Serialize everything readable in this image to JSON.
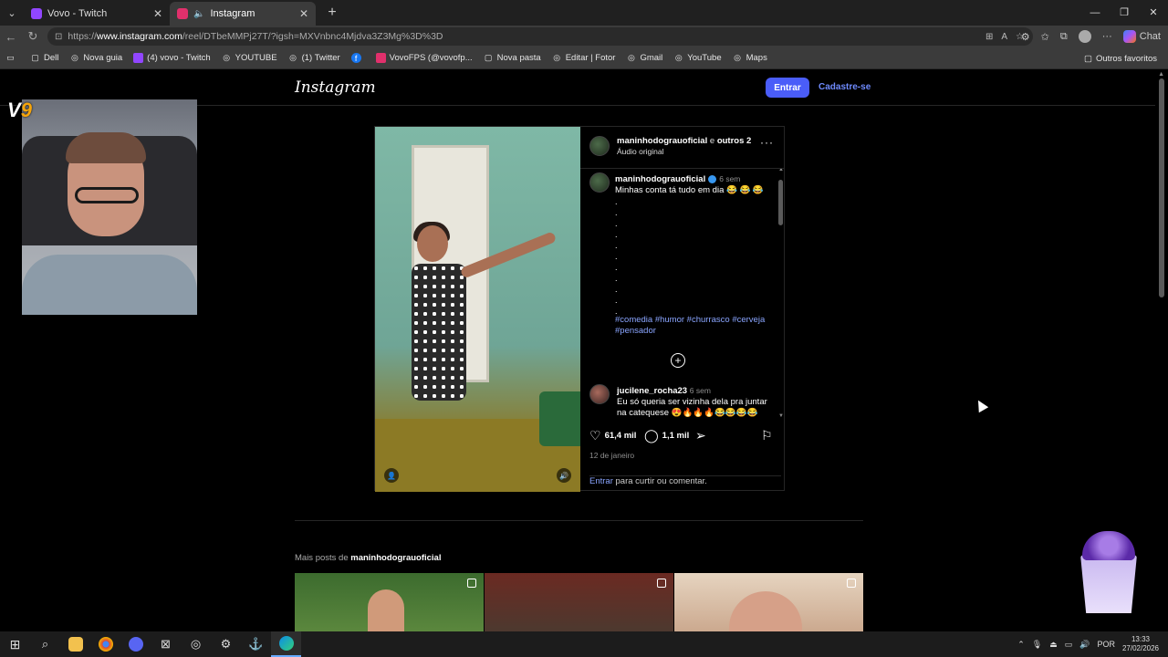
{
  "browser": {
    "tabs": [
      {
        "label": "Vovo - Twitch",
        "color": "#9146ff"
      },
      {
        "label": "Instagram",
        "color": "#e1306c"
      }
    ],
    "url_prefix": "https://",
    "url_host": "www.instagram.com",
    "url_path": "/reel/DTbeMMPj27T/?igsh=MXVnbnc4Mjdva3Z3Mg%3D%3D",
    "chat_label": "Chat",
    "bookmarks": [
      {
        "label": "Dell",
        "icon": "folder-icon"
      },
      {
        "label": "Nova guia",
        "icon": "globe-icon"
      },
      {
        "label": "(4) vovo - Twitch",
        "icon": "twitch-icon"
      },
      {
        "label": "YOUTUBE",
        "icon": "globe-icon"
      },
      {
        "label": "(1) Twitter",
        "icon": "globe-icon"
      },
      {
        "label": "",
        "icon": "facebook-icon"
      },
      {
        "label": "VovoFPS (@vovofp...",
        "icon": "instagram-icon"
      },
      {
        "label": "Nova pasta",
        "icon": "folder-icon"
      },
      {
        "label": "Editar | Fotor",
        "icon": "globe-icon"
      },
      {
        "label": "Gmail",
        "icon": "globe-icon"
      },
      {
        "label": "YouTube",
        "icon": "globe-icon"
      },
      {
        "label": "Maps",
        "icon": "globe-icon"
      }
    ],
    "other_favorites": "Outros favoritos"
  },
  "instagram": {
    "logo": "Instagram",
    "login_button": "Entrar",
    "signup_link": "Cadastre-se",
    "post": {
      "author": "maninhodograuoficial",
      "coauthor_text": "e",
      "coauthors": "outros 2",
      "audio": "Áudio original",
      "caption_author": "maninhodograuoficial",
      "caption_time": "6 sem",
      "caption": "Minhas conta tá tudo em dia 😂 😂 😂",
      "dots": ".\n.\n.\n.\n.\n.\n.\n.\n.\n.\n.",
      "hashtags": "#comedia #humor #churrasco #cerveja #pensador",
      "comment": {
        "user": "jucilene_rocha23",
        "time": "6 sem",
        "text": "Eu só queria ser vizinha dela pra juntar na catequese 😍🔥🔥🔥😂😂😂😂"
      },
      "likes": "61,4 mil",
      "comments_count": "1,1 mil",
      "date": "12 de janeiro",
      "login_link": "Entrar",
      "login_text": " para curtir ou comentar."
    },
    "more_posts_prefix": "Mais posts de ",
    "more_posts_user": "maninhodograuoficial"
  },
  "taskbar": {
    "lang": "POR",
    "time": "13:33",
    "date": "27/02/2026"
  }
}
